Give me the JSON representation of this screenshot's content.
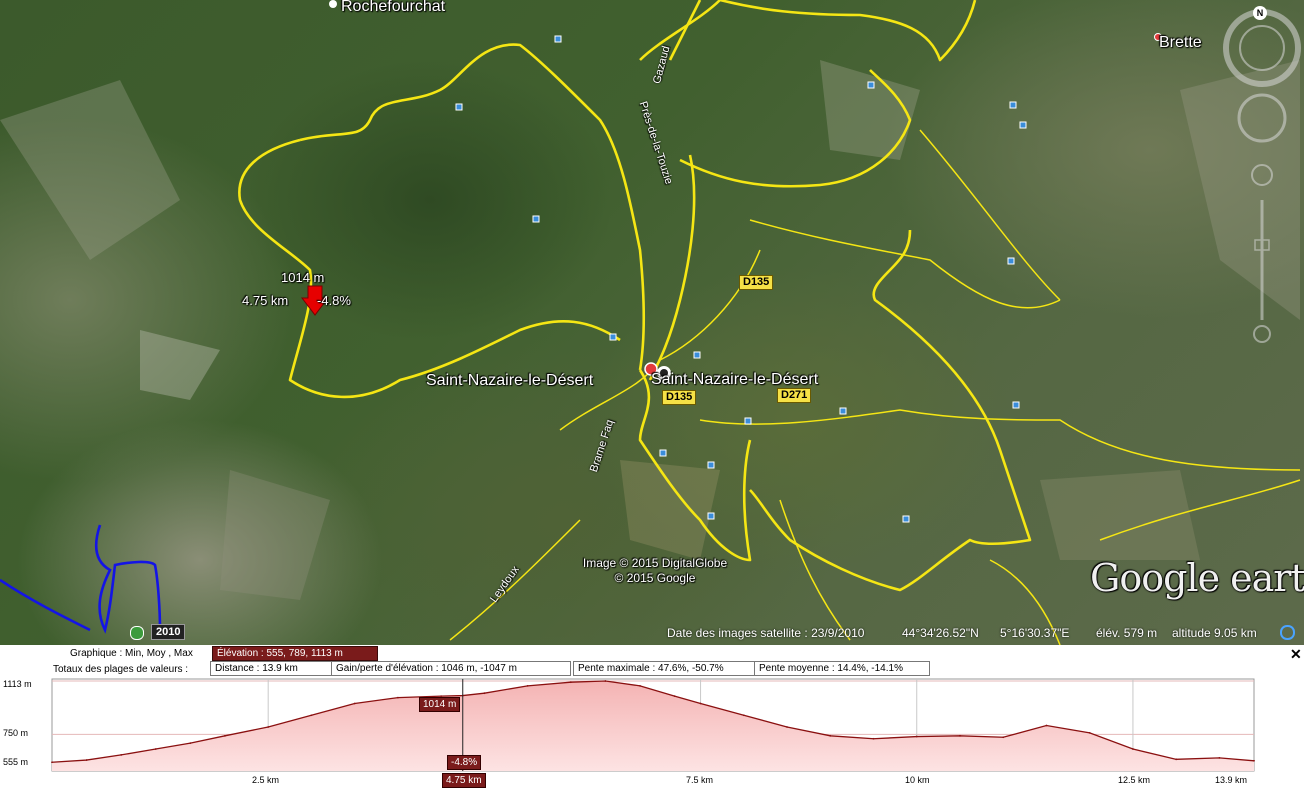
{
  "map": {
    "places": {
      "rochefourchat": "Rochefourchat",
      "brette": "Brette",
      "saint_nazaire_left": "Saint-Nazaire-le-Désert",
      "saint_nazaire_right": "Saint-Nazaire-le-Désert"
    },
    "roads": {
      "d135_a": "D135",
      "d135_b": "D135",
      "d271": "D271"
    },
    "streets": {
      "gazaud": "Gazaud",
      "pres": "Près-de-la-Touzie",
      "brame_faq": "Brame Faq",
      "leydoux": "Leydoux"
    },
    "track_marker": {
      "elevation": "1014 m",
      "distance": "4.75 km",
      "slope": "-4.8%"
    },
    "copyright": [
      "Image © 2015 DigitalGlobe",
      "© 2015 Google"
    ],
    "logo": "Google earth",
    "compass_north": "N",
    "historical_year": "2010",
    "status": {
      "imagery_date": "Date des images satellite : 23/9/2010",
      "lat": "44°34'26.52\"N",
      "lon": "5°16'30.37\"E",
      "elev": "élév.   579 m",
      "altitude": "altitude    9.05 km"
    },
    "colors": {
      "track": "#f5e614",
      "route": "#1414e6"
    }
  },
  "profile": {
    "graph_label": "Graphique : Min, Moy , Max",
    "elevation_pill": "Élévation : 555, 789, 1113 m",
    "totals_label": "Totaux des plages de valeurs :",
    "distance_pill": "Distance : 13.9 km",
    "gain_pill": "Gain/perte d'élévation : 1046 m, -1047 m",
    "max_slope_pill": "Pente maximale : 47.6%, -50.7%",
    "avg_slope_pill": "Pente moyenne : 14.4%, -14.1%",
    "close": "✕",
    "y_ticks": [
      "1113 m",
      "750 m",
      "555 m"
    ],
    "x_ticks": [
      "2.5 km",
      "7.5 km",
      "10 km",
      "12.5 km",
      "13.9 km"
    ],
    "cursor": {
      "distance": "4.75 km",
      "elevation": "1014 m",
      "slope": "-4.8%"
    },
    "chart_data": {
      "type": "area",
      "x_unit": "km",
      "y_unit": "m",
      "xlim": [
        0,
        13.9
      ],
      "ylim": [
        555,
        1113
      ],
      "x": [
        0,
        0.4,
        0.8,
        1.2,
        1.6,
        2.0,
        2.5,
        3.0,
        3.5,
        4.0,
        4.5,
        4.75,
        5.0,
        5.5,
        6.0,
        6.4,
        6.8,
        7.2,
        7.5,
        8.0,
        8.5,
        9.0,
        9.5,
        10.0,
        10.5,
        11.0,
        11.5,
        12.0,
        12.5,
        13.0,
        13.5,
        13.9
      ],
      "y": [
        560,
        575,
        610,
        650,
        690,
        740,
        800,
        880,
        960,
        1000,
        1010,
        1014,
        1030,
        1080,
        1105,
        1113,
        1080,
        1010,
        960,
        880,
        800,
        740,
        720,
        735,
        740,
        730,
        810,
        760,
        650,
        580,
        590,
        570
      ]
    }
  }
}
